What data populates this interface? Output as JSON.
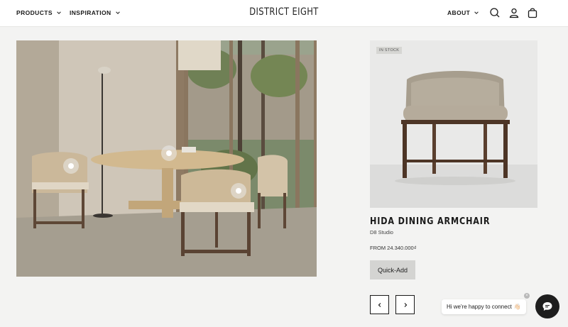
{
  "header": {
    "nav_left": [
      {
        "label": "PRODUCTS",
        "icon": "chevron-down-icon"
      },
      {
        "label": "INSPIRATION",
        "icon": "chevron-down-icon"
      }
    ],
    "logo": "DISTRICT EIGHT",
    "nav_right": {
      "label": "ABOUT",
      "icon": "chevron-down-icon"
    },
    "icons": [
      "search-icon",
      "user-icon",
      "shopping-bag-icon"
    ]
  },
  "scene": {
    "hotspots": 3
  },
  "product": {
    "badge": "IN STOCK",
    "title": "HIDA DINING ARMCHAIR",
    "brand": "D8 Studio",
    "price": "FROM 24.340.000₫",
    "cta": "Quick-Add"
  },
  "carousel": {
    "prev_icon": "chevron-left-icon",
    "next_icon": "chevron-right-icon"
  },
  "chat": {
    "message": "Hi we're happy to connect",
    "emoji": "👋🏻",
    "close": "×",
    "launcher_icon": "chat-icon"
  },
  "colors": {
    "background": "#f3f3f2",
    "header": "#ffffff",
    "quick_add": "#d4d4d2",
    "chat_launcher": "#1e1e1e"
  }
}
